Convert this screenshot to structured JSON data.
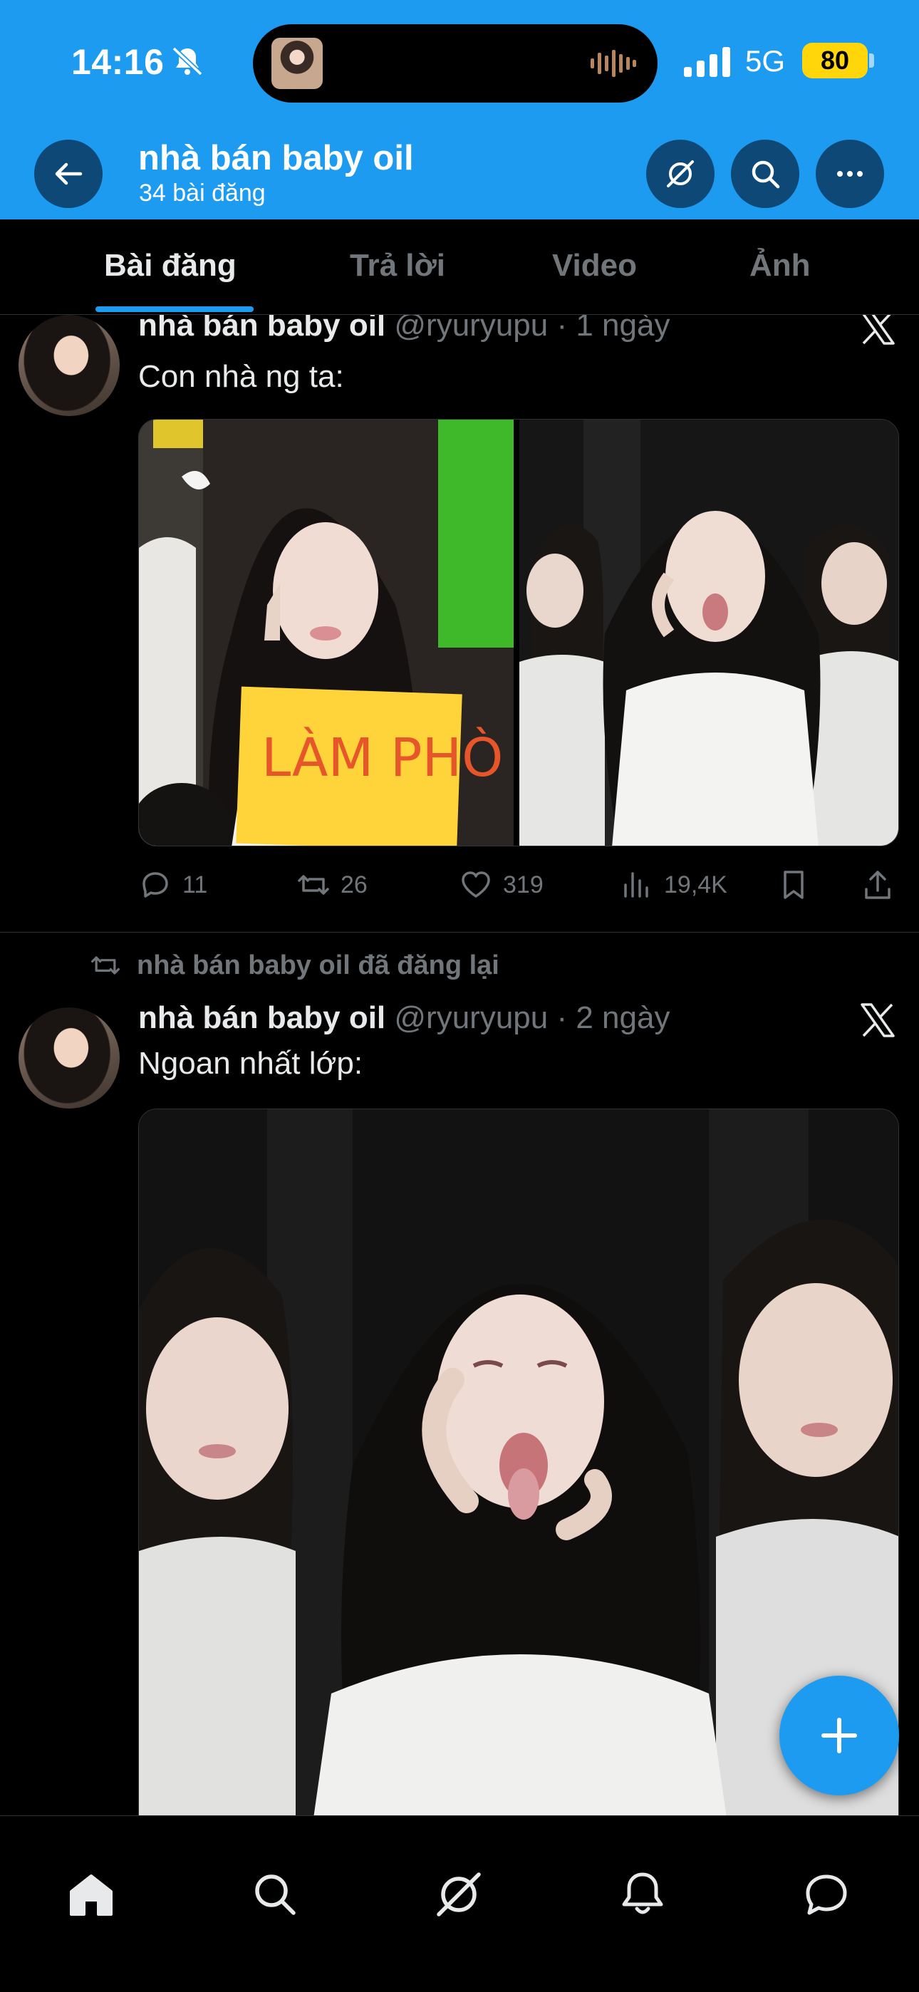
{
  "status_bar": {
    "time": "14:16",
    "network": "5G",
    "battery": "80",
    "icons": [
      "bell-slash-icon",
      "cellular-signal-icon",
      "audio-waveform-icon"
    ]
  },
  "header": {
    "title": "nhà bán baby oil",
    "subtitle": "34 bài đăng",
    "icons": [
      "back-arrow-icon",
      "grok-icon",
      "search-icon",
      "more-icon"
    ]
  },
  "tabs": [
    {
      "label": "Bài đăng",
      "active": true
    },
    {
      "label": "Trả lời",
      "active": false
    },
    {
      "label": "Video",
      "active": false
    },
    {
      "label": "Ảnh",
      "active": false
    }
  ],
  "posts": [
    {
      "author_name": "nhà bán baby oil",
      "meta": "@ryuryupu · 1 ngày",
      "text": "Con nhà ng ta:",
      "sign_text": "LÀM PHÒ",
      "replies": "11",
      "reposts": "26",
      "likes": "319",
      "views": "19,4K"
    },
    {
      "repost_label": "nhà bán baby oil đã đăng lại",
      "author_name": "nhà bán baby oil",
      "meta": "@ryuryupu · 2 ngày",
      "text": "Ngoan nhất lớp:"
    }
  ],
  "bottom_nav": [
    "home-icon",
    "search-icon",
    "grok-icon",
    "notifications-bell-icon",
    "messages-icon"
  ],
  "colors": {
    "accent": "#1d9bf0",
    "background": "#000000",
    "muted_text": "#71767b",
    "battery": "#ffd60a"
  }
}
